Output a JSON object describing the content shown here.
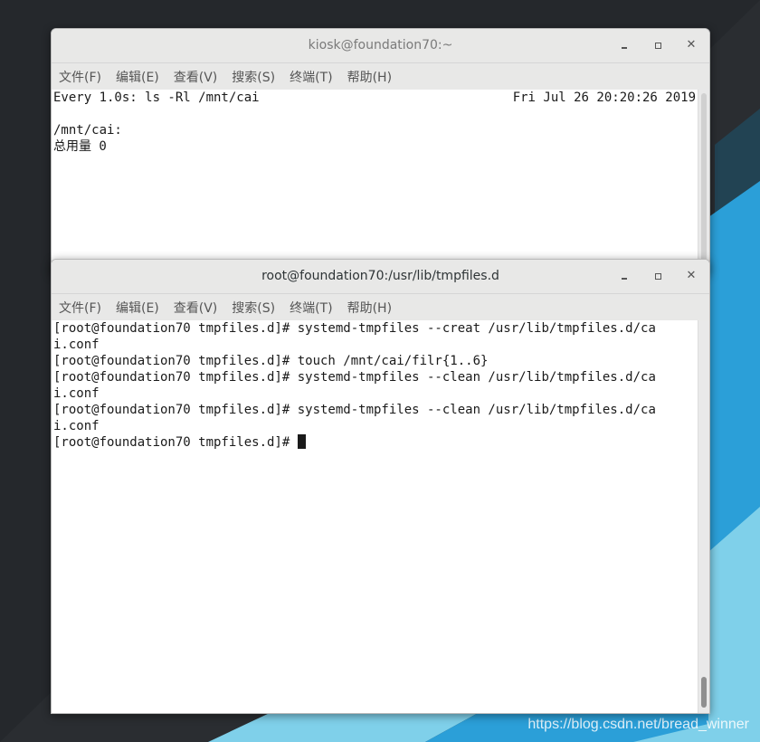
{
  "watermark": "https://blog.csdn.net/bread_winner",
  "window_top": {
    "title": "kiosk@foundation70:~",
    "menu": [
      "文件(F)",
      "编辑(E)",
      "查看(V)",
      "搜索(S)",
      "终端(T)",
      "帮助(H)"
    ],
    "header_left": "Every 1.0s: ls -Rl /mnt/cai",
    "header_right": "Fri Jul 26 20:20:26 2019",
    "lines": [
      "",
      "/mnt/cai:",
      "总用量 0"
    ]
  },
  "window_front": {
    "title": "root@foundation70:/usr/lib/tmpfiles.d",
    "menu": [
      "文件(F)",
      "编辑(E)",
      "查看(V)",
      "搜索(S)",
      "终端(T)",
      "帮助(H)"
    ],
    "lines": [
      "[root@foundation70 tmpfiles.d]# systemd-tmpfiles --creat /usr/lib/tmpfiles.d/ca",
      "i.conf",
      "[root@foundation70 tmpfiles.d]# touch /mnt/cai/filr{1..6}",
      "[root@foundation70 tmpfiles.d]# systemd-tmpfiles --clean /usr/lib/tmpfiles.d/ca",
      "i.conf",
      "[root@foundation70 tmpfiles.d]# systemd-tmpfiles --clean /usr/lib/tmpfiles.d/ca",
      "i.conf"
    ],
    "prompt": "[root@foundation70 tmpfiles.d]# "
  },
  "colors": {
    "accent_blue": "#2b9fd8",
    "light_blue": "#7fd0ea",
    "desktop_dark": "#24272b"
  }
}
